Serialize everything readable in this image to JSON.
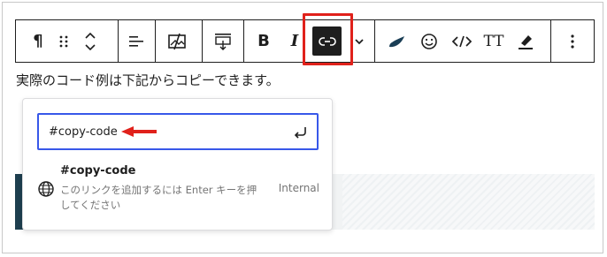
{
  "toolbar": {
    "paragraph_icon": "¶",
    "bold_label": "B",
    "italic_label": "I",
    "text_size_label": "TT",
    "icons": [
      "paragraph-icon",
      "drag-handle-icon",
      "move-up-down-icon",
      "align-icon",
      "toggle-image-icon",
      "height-icon",
      "bold-icon",
      "italic-icon",
      "link-icon",
      "more-rich-text-chevron-icon",
      "leaf-icon",
      "emoji-icon",
      "code-icon",
      "text-size-icon",
      "highlighter-icon",
      "more-options-icon"
    ]
  },
  "paragraph": {
    "text": "実際のコード例は下記からコピーできます。"
  },
  "link_popover": {
    "input_value": "#copy-code",
    "suggestion": {
      "title": "#copy-code",
      "description": "このリンクを追加するには Enter キーを押してください",
      "type": "Internal"
    }
  },
  "colors": {
    "accent": "#3858e9",
    "highlight_red": "#e0211b",
    "toolbar_active": "#1e1e1e",
    "block_dark": "#1e3f4f"
  }
}
